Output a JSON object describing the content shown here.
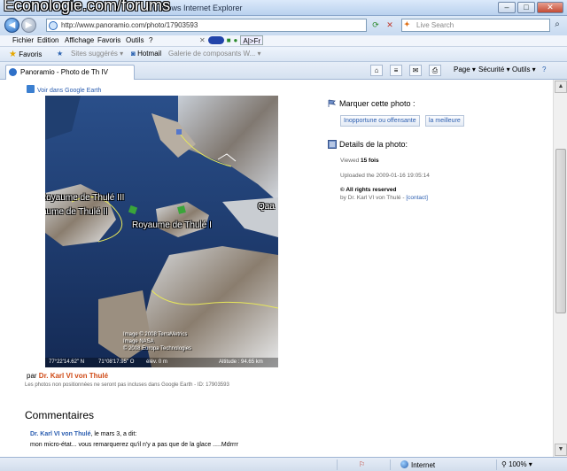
{
  "window": {
    "watermark": "Econologie.com/forums",
    "title_rest": "Windows Internet Explorer",
    "minimize": "–",
    "maximize": "□",
    "close": "✕"
  },
  "address_bar": {
    "url": "http://www.panoramio.com/photo/17903593",
    "search_placeholder": "Live Search"
  },
  "menu": {
    "items": [
      "Fichier",
      "Edition",
      "Affichage",
      "Favoris",
      "Outils",
      "?"
    ],
    "addon_label": "A|>Fr"
  },
  "favorites_bar": {
    "favorites": "Favoris",
    "suggested": "Sites suggérés",
    "hotmail": "Hotmail",
    "gallery": "Galerie de composants W..."
  },
  "tab": {
    "label": "Panoramio - Photo de Th IV"
  },
  "command_bar": {
    "page": "Page",
    "security": "Sécurité",
    "tools": "Outils"
  },
  "page": {
    "earth_link": "Voir dans Google Earth",
    "map_labels": {
      "thule_iii": "Royaume de Thulé III",
      "thule_ii": "aume de Thulé II",
      "thule_i": "Royaume de Thulé I",
      "qaa": "Qaa"
    },
    "map_copyright": [
      "Image © 2008 TerraMetrics",
      "Image NASA",
      "© 2008 Europa Technologies"
    ],
    "map_status": {
      "lat": "77°22'14.62\" N",
      "lon": "71°08'17.95\" O",
      "elev": "élév.   0 m",
      "altitude": "Altitude : 94.65 km"
    },
    "by_prefix": "par",
    "author": "Dr. Karl VI von Thulé",
    "note": "Les photos non positionnées ne seront pas incluses dans Google Earth - ID: 17903593",
    "comments_heading": "Commentaires",
    "comment": {
      "author": "Dr. Karl VI von Thulé",
      "meta": ", le mars 3, a dit:",
      "text": "mon micro-état... vous remarquerez qu'il n'y a pas que de la glace .....Mdrrrr"
    },
    "mark_heading": "Marquer cette photo :",
    "btn_inappropriate": "Inopportune ou offensante",
    "btn_best": "la meilleure",
    "details_heading": "Details de la photo:",
    "viewed_prefix": "Viewed",
    "viewed_count": "15 fois",
    "uploaded": "Uploaded the 2009-01-16 19:05:14",
    "rights": "© All rights reserved",
    "by_detail": "by Dr. Karl VI von Thulé -",
    "contact": "[contact]"
  },
  "status_bar": {
    "zone": "Internet",
    "zoom": "100%"
  }
}
